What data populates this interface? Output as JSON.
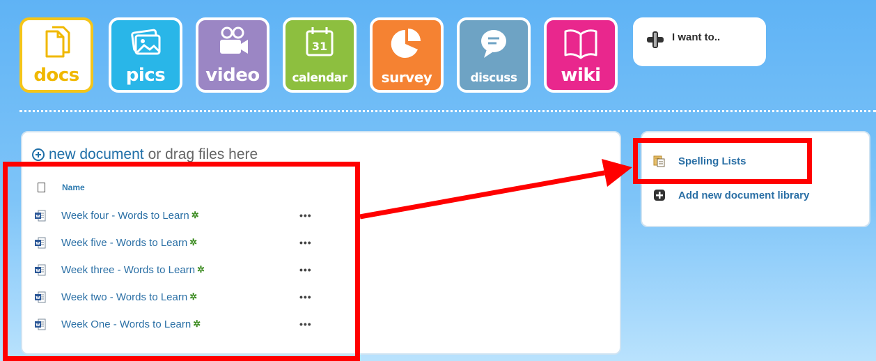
{
  "nav": {
    "tiles": [
      {
        "label": "docs",
        "icon": "documents-icon"
      },
      {
        "label": "pics",
        "icon": "pictures-icon"
      },
      {
        "label": "video",
        "icon": "video-camera-icon"
      },
      {
        "label": "calendar",
        "icon": "calendar-icon",
        "calendar_day": "31"
      },
      {
        "label": "survey",
        "icon": "pie-chart-icon"
      },
      {
        "label": "discuss",
        "icon": "speech-bubble-icon"
      },
      {
        "label": "wiki",
        "icon": "open-book-icon"
      }
    ],
    "i_want_to": "I want to.."
  },
  "main": {
    "new_document_link": "new document",
    "new_document_suffix": "or drag files here",
    "column_name": "Name",
    "more_label": "•••",
    "new_badge": "✲",
    "documents": [
      {
        "name": "Week four - Words to Learn"
      },
      {
        "name": "Week five - Words to Learn"
      },
      {
        "name": "Week three - Words to Learn"
      },
      {
        "name": "Week two - Words to Learn"
      },
      {
        "name": "Week One - Words to Learn"
      }
    ]
  },
  "sidebar": {
    "libraries": [
      {
        "label": "Spelling Lists",
        "icon": "document-library-icon"
      },
      {
        "label": "Add new document library",
        "icon": "add-icon"
      }
    ]
  },
  "colors": {
    "annotation": "#ff0000",
    "docs_accent": "#f5c518",
    "link": "#2a6fa5"
  }
}
